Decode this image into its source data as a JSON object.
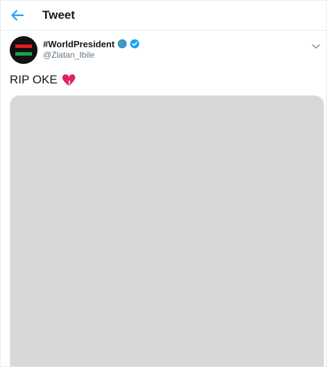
{
  "header": {
    "title": "Tweet"
  },
  "author": {
    "display_name": "#WorldPresident",
    "handle": "@Zlatan_Ibile"
  },
  "tweet": {
    "text": "RIP OKE"
  },
  "colors": {
    "accent": "#1da1f2",
    "text": "#14171a",
    "muted": "#657786",
    "border": "#e6ecf0"
  },
  "icons": {
    "back": "arrow-left-icon",
    "globe": "globe-icon",
    "verified": "verified-icon",
    "more": "chevron-down-icon",
    "emoji": "broken-heart-icon"
  }
}
